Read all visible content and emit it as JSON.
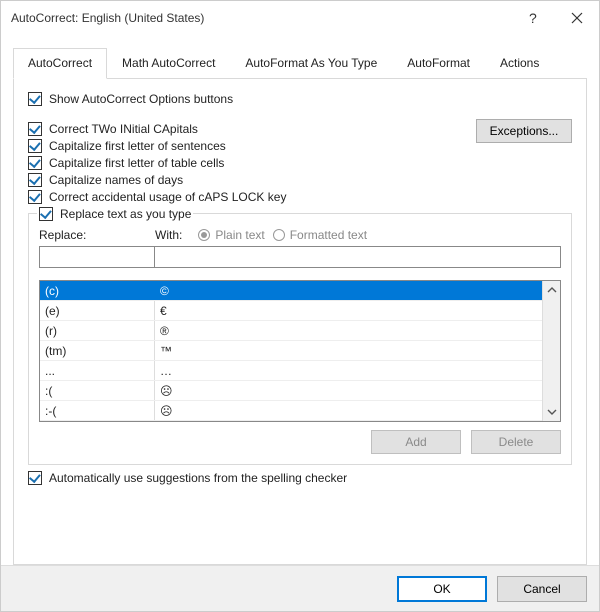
{
  "title": "AutoCorrect: English (United States)",
  "tabs": [
    "AutoCorrect",
    "Math AutoCorrect",
    "AutoFormat As You Type",
    "AutoFormat",
    "Actions"
  ],
  "active_tab": 0,
  "show_autocorrect_options": "Show AutoCorrect Options buttons",
  "opt": {
    "two_initial": "Correct TWo INitial CApitals",
    "first_sentence": "Capitalize first letter of sentences",
    "first_table": "Capitalize first letter of table cells",
    "days": "Capitalize names of days",
    "capslock": "Correct accidental usage of cAPS LOCK key"
  },
  "exceptions_label": "Exceptions...",
  "replace_legend": "Replace text as you type",
  "replace_label": "Replace:",
  "with_label": "With:",
  "radio_plain": "Plain text",
  "radio_formatted": "Formatted text",
  "inputs": {
    "replace_value": "",
    "with_value": ""
  },
  "entries": [
    {
      "from": "(c)",
      "to": "©"
    },
    {
      "from": "(e)",
      "to": "€"
    },
    {
      "from": "(r)",
      "to": "®"
    },
    {
      "from": "(tm)",
      "to": "™"
    },
    {
      "from": "...",
      "to": "…"
    },
    {
      "from": ":(",
      "to": "☹"
    },
    {
      "from": ":-(",
      "to": "☹"
    }
  ],
  "selected_entry": 0,
  "add_label": "Add",
  "delete_label": "Delete",
  "spellcheck_opt": "Automatically use suggestions from the spelling checker",
  "ok_label": "OK",
  "cancel_label": "Cancel"
}
